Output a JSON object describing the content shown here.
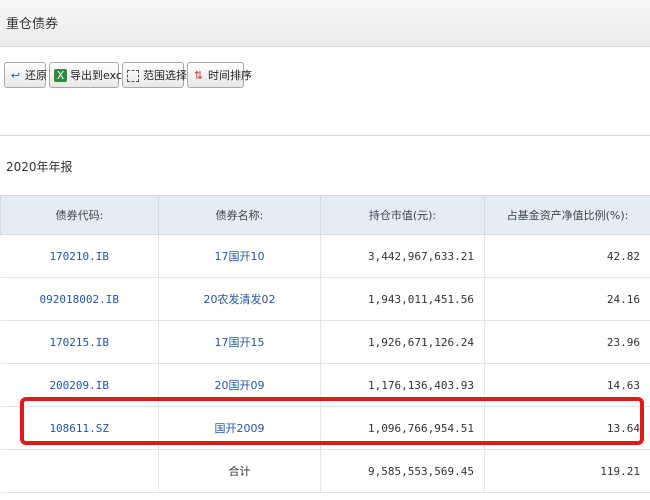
{
  "window": {
    "title": "重仓债券"
  },
  "toolbar": {
    "restore_label": "还原",
    "export_label": "导出到excel",
    "range_label": "范围选择",
    "sort_label": "时间排序"
  },
  "report": {
    "period": "2020年年报"
  },
  "table": {
    "headers": [
      "债券代码:",
      "债券名称:",
      "持仓市值(元):",
      "占基金资产净值比例(%):"
    ],
    "rows": [
      {
        "code": "170210.IB",
        "name": "17国开10",
        "value": "3,442,967,633.21",
        "ratio": "42.82"
      },
      {
        "code": "092018002.IB",
        "name": "20农发清发02",
        "value": "1,943,011,451.56",
        "ratio": "24.16"
      },
      {
        "code": "170215.IB",
        "name": "17国开15",
        "value": "1,926,671,126.24",
        "ratio": "23.96"
      },
      {
        "code": "200209.IB",
        "name": "20国开09",
        "value": "1,176,136,403.93",
        "ratio": "14.63"
      },
      {
        "code": "108611.SZ",
        "name": "国开2009",
        "value": "1,096,766,954.51",
        "ratio": "13.64"
      }
    ],
    "total": {
      "label": "合计",
      "value": "9,585,553,569.45",
      "ratio": "119.21"
    }
  },
  "colors": {
    "highlight": "#e0191b",
    "link": "#2356a6",
    "header_bg": "#e4ecf7"
  }
}
